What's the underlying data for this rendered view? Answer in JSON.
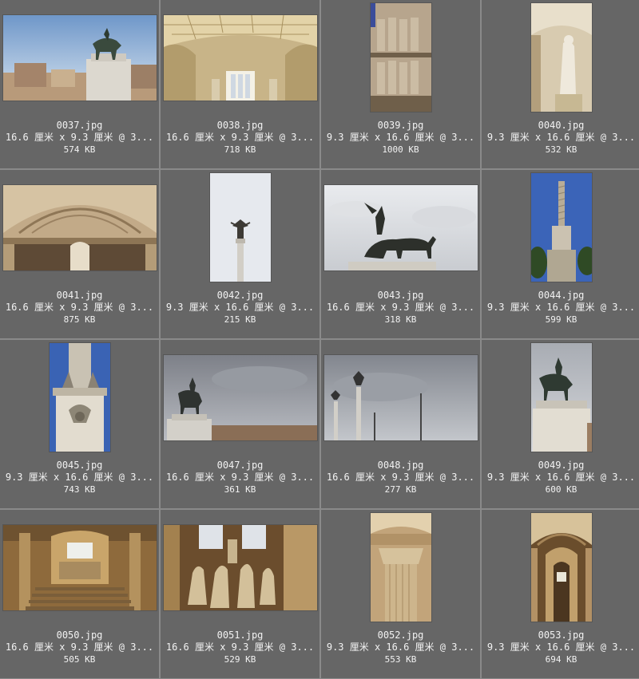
{
  "thumbnails": [
    {
      "filename": "0037.jpg",
      "dimensions": "16.6 厘米 x 9.3 厘米 @ 3...",
      "filesize": "574 KB",
      "orientation": "landscape",
      "subject": "equestrian-statue-monument"
    },
    {
      "filename": "0038.jpg",
      "dimensions": "16.6 厘米 x 9.3 厘米 @ 3...",
      "filesize": "718 KB",
      "orientation": "landscape",
      "subject": "coffered-ceiling-hall"
    },
    {
      "filename": "0039.jpg",
      "dimensions": "9.3 厘米 x 16.6 厘米 @ 3...",
      "filesize": "1000 KB",
      "orientation": "portrait",
      "subject": "cathedral-portal-statues"
    },
    {
      "filename": "0040.jpg",
      "dimensions": "9.3 厘米 x 16.6 厘米 @ 3...",
      "filesize": "532 KB",
      "orientation": "portrait",
      "subject": "marble-statue-arch"
    },
    {
      "filename": "0041.jpg",
      "dimensions": "16.6 厘米 x 9.3 厘米 @ 3...",
      "filesize": "875 KB",
      "orientation": "landscape",
      "subject": "gothic-portal-tympanum"
    },
    {
      "filename": "0042.jpg",
      "dimensions": "9.3 厘米 x 16.6 厘米 @ 3...",
      "filesize": "215 KB",
      "orientation": "portrait",
      "subject": "column-with-winged-statue"
    },
    {
      "filename": "0043.jpg",
      "dimensions": "16.6 厘米 x 9.3 厘米 @ 3...",
      "filesize": "318 KB",
      "orientation": "landscape",
      "subject": "quadriga-sculpture"
    },
    {
      "filename": "0044.jpg",
      "dimensions": "9.3 厘米 x 16.6 厘米 @ 3...",
      "filesize": "599 KB",
      "orientation": "portrait",
      "subject": "tall-column-blue-sky"
    },
    {
      "filename": "0045.jpg",
      "dimensions": "9.3 厘米 x 16.6 厘米 @ 3...",
      "filesize": "743 KB",
      "orientation": "portrait",
      "subject": "column-base-eagle-relief"
    },
    {
      "filename": "0047.jpg",
      "dimensions": "16.6 厘米 x 9.3 厘米 @ 3...",
      "filesize": "361 KB",
      "orientation": "landscape",
      "subject": "equestrian-statue-cloudy"
    },
    {
      "filename": "0048.jpg",
      "dimensions": "16.6 厘米 x 9.3 厘米 @ 3...",
      "filesize": "277 KB",
      "orientation": "landscape",
      "subject": "columns-cloudy-sky"
    },
    {
      "filename": "0049.jpg",
      "dimensions": "9.3 厘米 x 16.6 厘米 @ 3...",
      "filesize": "600 KB",
      "orientation": "portrait",
      "subject": "equestrian-statue-pedestal"
    },
    {
      "filename": "0050.jpg",
      "dimensions": "16.6 厘米 x 9.3 厘米 @ 3...",
      "filesize": "505 KB",
      "orientation": "landscape",
      "subject": "interior-staircase-hall"
    },
    {
      "filename": "0051.jpg",
      "dimensions": "16.6 厘米 x 9.3 厘米 @ 3...",
      "filesize": "529 KB",
      "orientation": "landscape",
      "subject": "horse-sculpture-interior"
    },
    {
      "filename": "0052.jpg",
      "dimensions": "9.3 厘米 x 16.6 厘米 @ 3...",
      "filesize": "553 KB",
      "orientation": "portrait",
      "subject": "corinthian-column-capital"
    },
    {
      "filename": "0053.jpg",
      "dimensions": "9.3 厘米 x 16.6 厘米 @ 3...",
      "filesize": "694 KB",
      "orientation": "portrait",
      "subject": "arched-corridor-interior"
    }
  ]
}
